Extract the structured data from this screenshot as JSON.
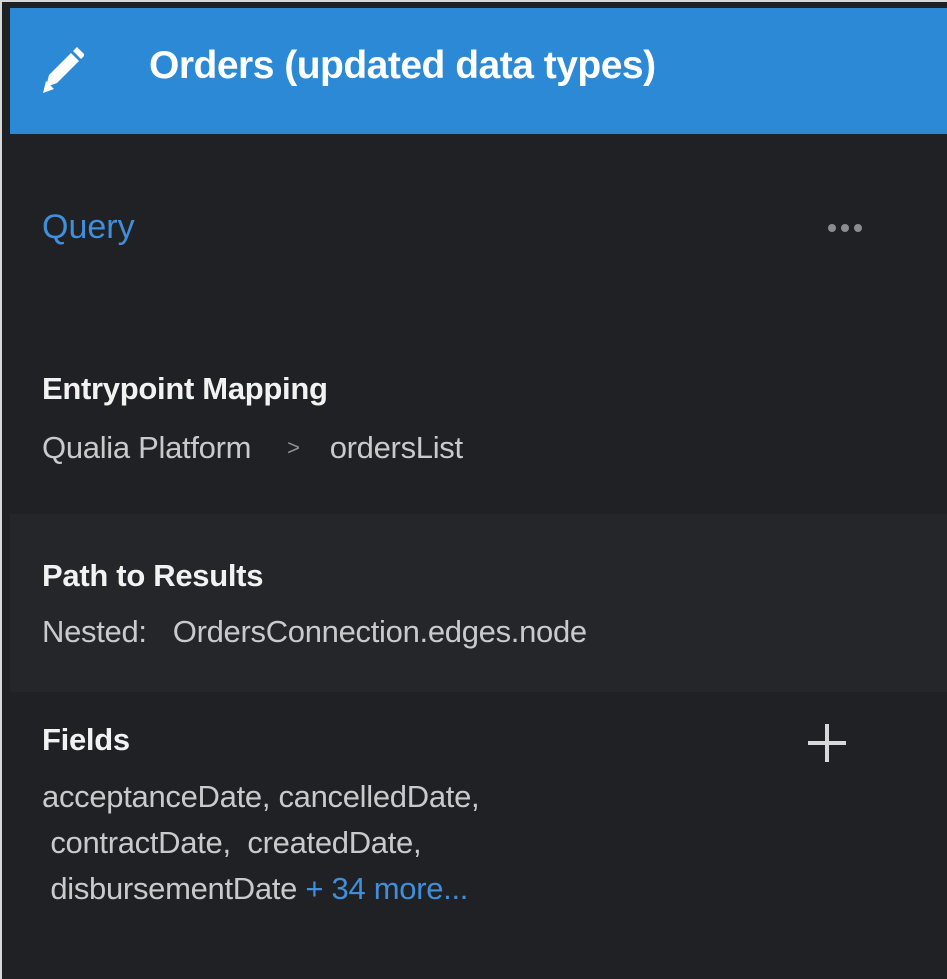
{
  "header": {
    "title": "Orders (updated data types)",
    "icon": "pencil-icon"
  },
  "query": {
    "label": "Query",
    "menu_icon": "more-horizontal-icon"
  },
  "entrypoint": {
    "title": "Entrypoint Mapping",
    "platform": "Qualia Platform",
    "separator": ">",
    "target": "ordersList"
  },
  "path_to_results": {
    "title": "Path to Results",
    "prefix": "Nested:",
    "value": "OrdersConnection.edges.node"
  },
  "fields": {
    "title": "Fields",
    "line1": "acceptanceDate,  cancelledDate,",
    "line2": " contractDate,  createdDate,",
    "line3": " disbursementDate",
    "more": "+ 34 more...",
    "add_icon": "plus-icon"
  },
  "colors": {
    "header_bg": "#2b89d6",
    "panel_bg": "#202124",
    "accent": "#3f8fdc",
    "text": "#c9cacc"
  }
}
